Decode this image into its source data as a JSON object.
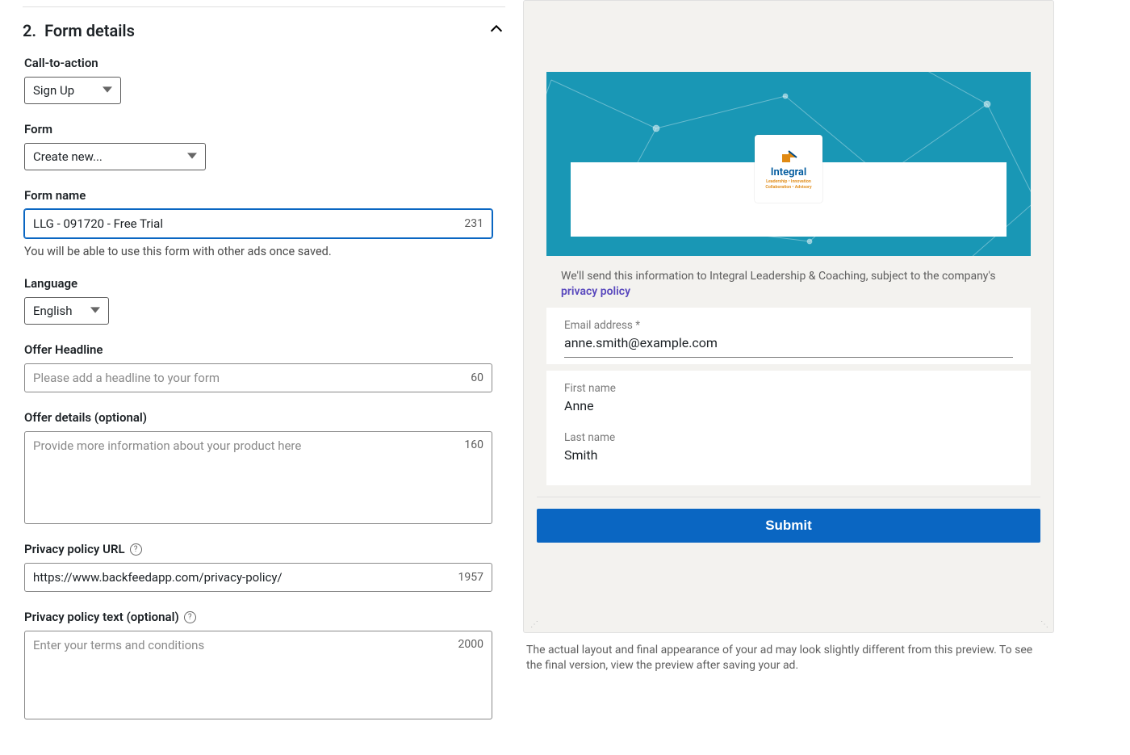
{
  "section": {
    "number": "2.",
    "title": "Form details"
  },
  "cta": {
    "label": "Call-to-action",
    "value": "Sign Up"
  },
  "form_select": {
    "label": "Form",
    "value": "Create new..."
  },
  "form_name": {
    "label": "Form name",
    "value": "LLG - 091720 - Free Trial",
    "count": "231",
    "hint": "You will be able to use this form with other ads once saved."
  },
  "language": {
    "label": "Language",
    "value": "English"
  },
  "headline": {
    "label": "Offer Headline",
    "placeholder": "Please add a headline to your form",
    "count": "60"
  },
  "details": {
    "label": "Offer details (optional)",
    "placeholder": "Provide more information about your product here",
    "count": "160"
  },
  "privacy_url": {
    "label": "Privacy policy URL",
    "value": "https://www.backfeedapp.com/privacy-policy/",
    "count": "1957"
  },
  "privacy_text": {
    "label": "Privacy policy text (optional)",
    "placeholder": "Enter your terms and conditions",
    "count": "2000"
  },
  "preview": {
    "company": "Integral Leadership & Coaching",
    "consent_prefix": "We'll send this information to ",
    "consent_suffix": ", subject to the company's ",
    "privacy_link": "privacy policy",
    "logo_word": "Integral",
    "logo_tag1": "Leadership • Innovation",
    "logo_tag2": "Collaboration • Advisory",
    "email_label": "Email address *",
    "email_value": "anne.smith@example.com",
    "first_label": "First name",
    "first_value": "Anne",
    "last_label": "Last name",
    "last_value": "Smith",
    "submit_label": "Submit",
    "footnote": "The actual layout and final appearance of your ad may look slightly different from this preview. To see the final version, view the preview after saving your ad."
  }
}
